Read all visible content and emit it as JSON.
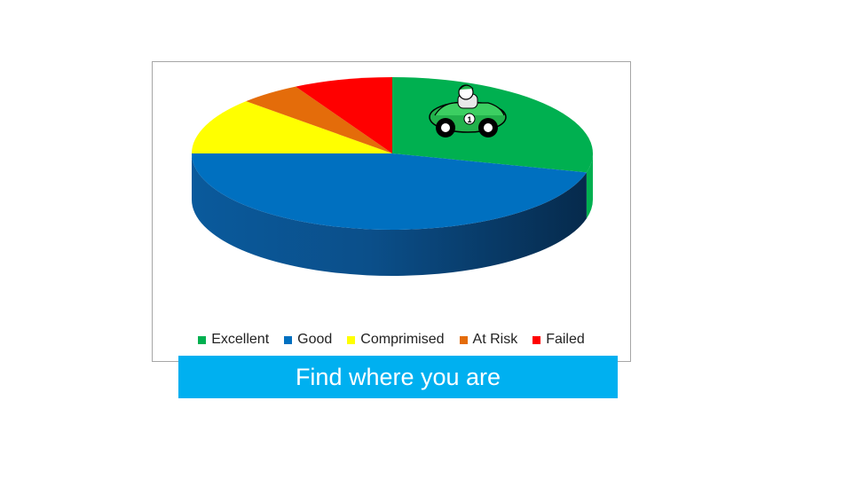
{
  "colors": {
    "banner_bg": "#00b0f0",
    "frame_border": "#a6a6a6"
  },
  "chart_data": {
    "type": "pie",
    "style": "3d",
    "title": "",
    "categories": [
      "Excellent",
      "Good",
      "Comprimised",
      "At Risk",
      "Failed"
    ],
    "values": [
      29,
      46,
      12,
      5,
      8
    ],
    "colors": [
      "#00b050",
      "#0070c0",
      "#ffff00",
      "#e46c0a",
      "#ff0000"
    ],
    "legend_position": "bottom",
    "decoration": "race-car-icon"
  },
  "legend": {
    "items": [
      {
        "label": "Excellent"
      },
      {
        "label": "Good"
      },
      {
        "label": "Comprimised"
      },
      {
        "label": "At Risk"
      },
      {
        "label": "Failed"
      }
    ]
  },
  "banner": {
    "text": "Find where you are"
  },
  "car": {
    "number": "1"
  }
}
